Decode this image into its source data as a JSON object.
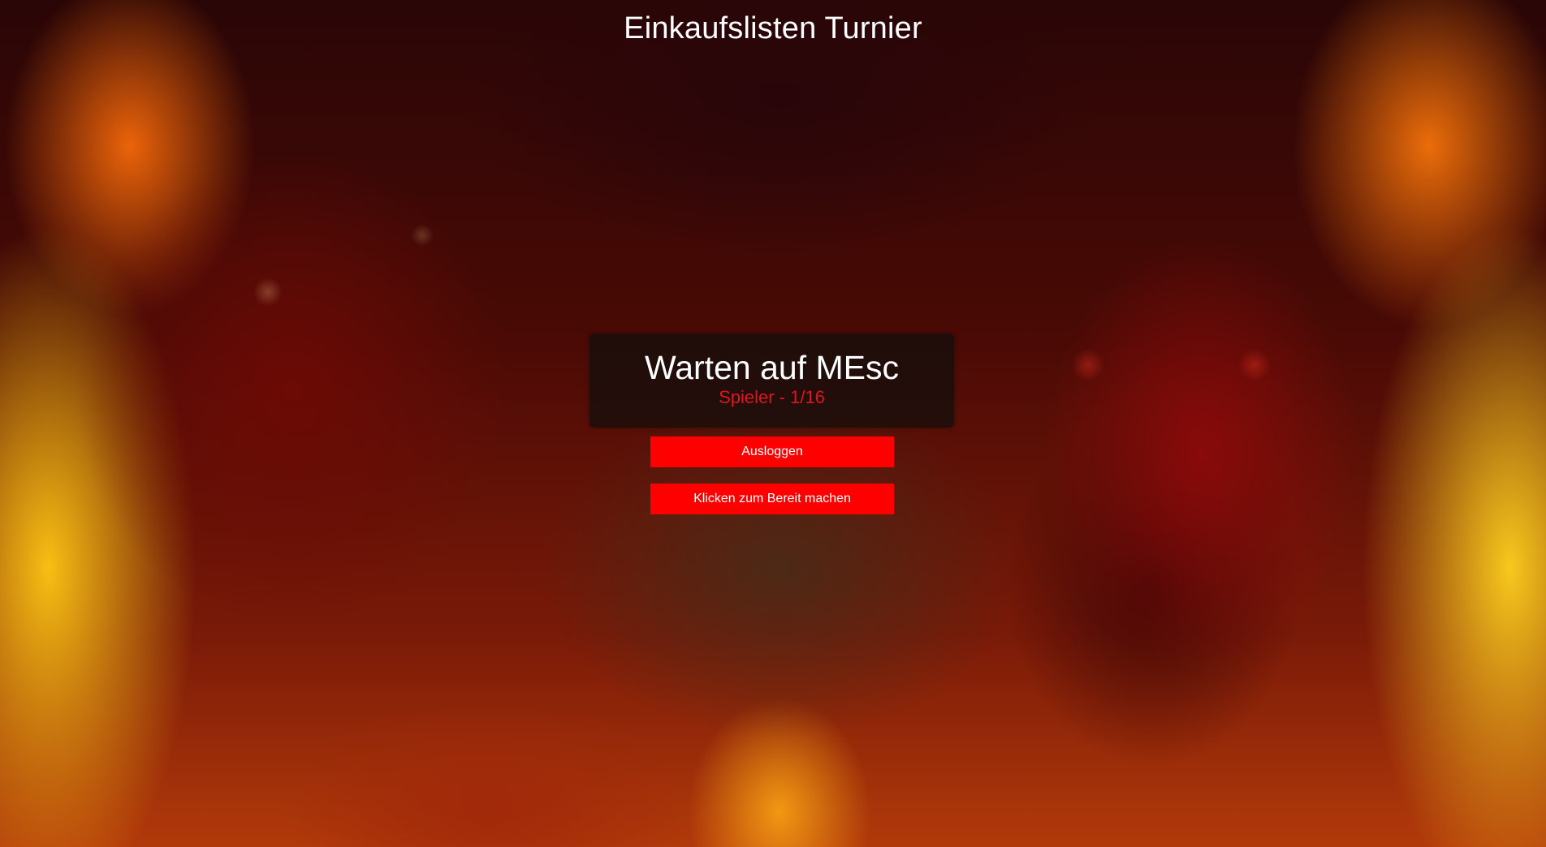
{
  "app": {
    "title": "Einkaufslisten Turnier"
  },
  "status_panel": {
    "heading": "Warten auf MEsc",
    "players": "Spieler - 1/16"
  },
  "actions": {
    "logout_label": "Ausloggen",
    "ready_label": "Klicken zum Bereit machen"
  },
  "colors": {
    "accent": "#ff0000",
    "subtext": "#e0141e",
    "panel_bg": "#140e0c"
  }
}
